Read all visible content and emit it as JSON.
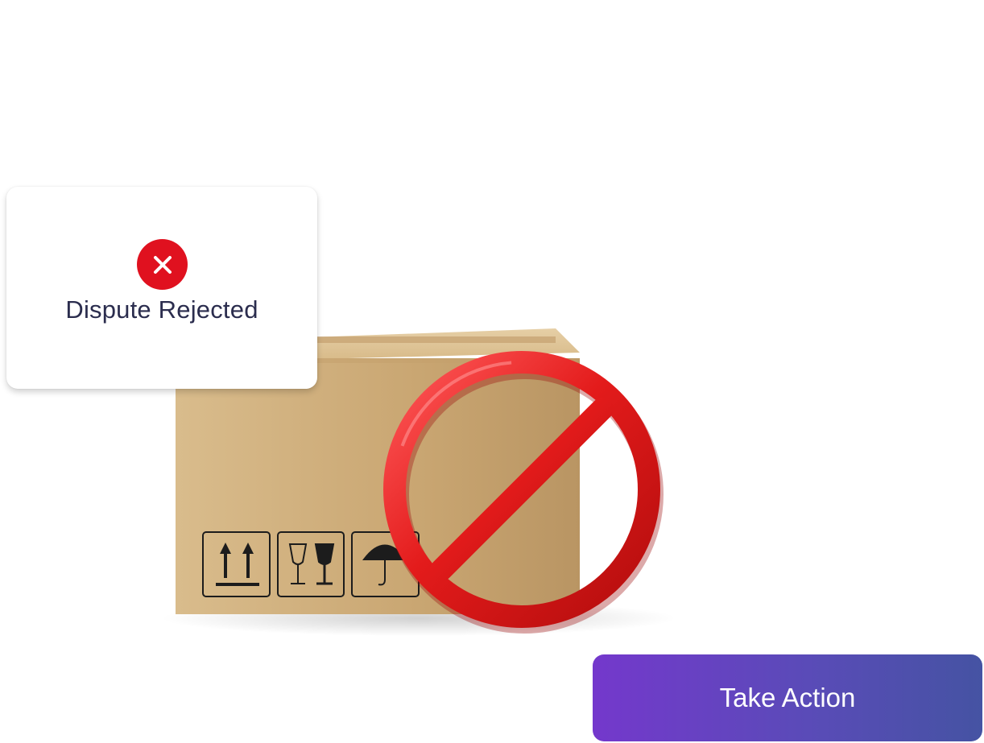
{
  "toast": {
    "status_icon": "close-icon",
    "title": "Dispute Rejected"
  },
  "illustration": {
    "subject": "cardboard-box-icon",
    "overlay": "prohibited-icon",
    "box_marks": [
      "this-way-up-icon",
      "fragile-icon",
      "keep-dry-icon"
    ]
  },
  "action": {
    "label": "Take Action"
  },
  "colors": {
    "reject_red": "#e0111f",
    "title_text": "#2b2d4e",
    "button_gradient_start": "#7438cc",
    "button_gradient_end": "#4553a3",
    "box_tan": "#cfae7c"
  }
}
